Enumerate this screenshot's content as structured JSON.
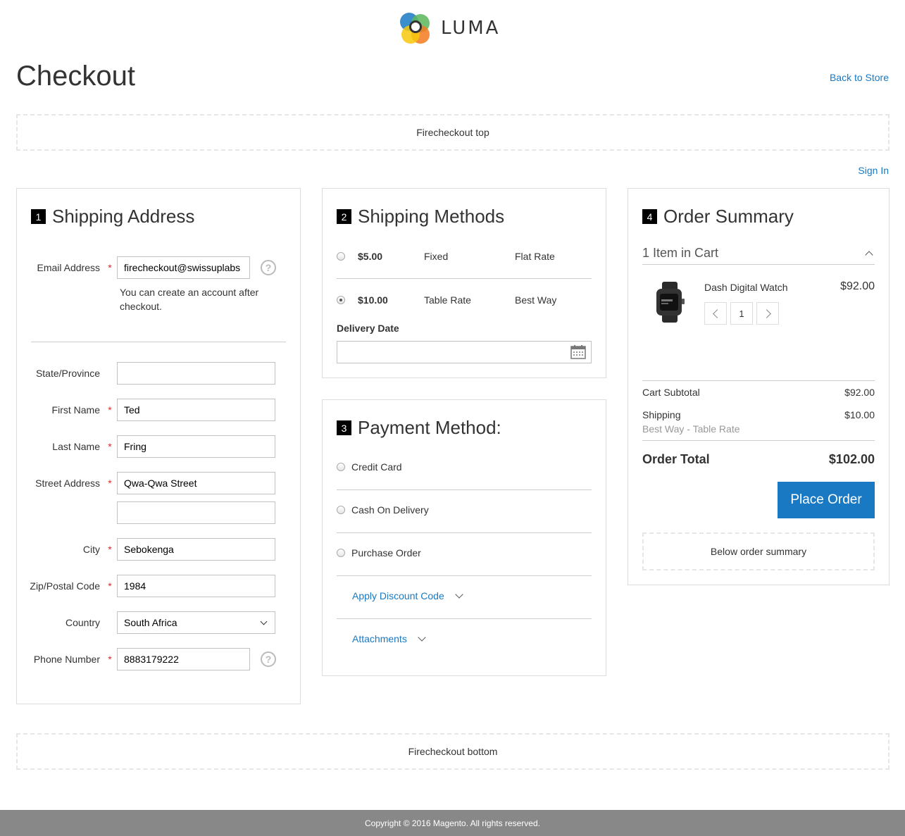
{
  "brand": {
    "name": "LUMA",
    "colors": {
      "blue": "#1979c3",
      "green": "#5bb75b",
      "orange": "#f47a20",
      "yellow": "#f7c80c"
    }
  },
  "header": {
    "title": "Checkout",
    "back_link": "Back to Store"
  },
  "top_box": "Firecheckout top",
  "sign_in": "Sign In",
  "shipping_address": {
    "step": "1",
    "title": "Shipping Address",
    "email": {
      "label": "Email Address",
      "value": "firecheckout@swissuplabs",
      "note": "You can create an account after checkout."
    },
    "state": {
      "label": "State/Province",
      "value": ""
    },
    "first_name": {
      "label": "First Name",
      "value": "Ted"
    },
    "last_name": {
      "label": "Last Name",
      "value": "Fring"
    },
    "street": {
      "label": "Street Address",
      "value": "Qwa-Qwa Street",
      "value2": ""
    },
    "city": {
      "label": "City",
      "value": "Sebokenga"
    },
    "zip": {
      "label": "Zip/Postal Code",
      "value": "1984"
    },
    "country": {
      "label": "Country",
      "value": "South Africa"
    },
    "phone": {
      "label": "Phone Number",
      "value": "8883179222"
    },
    "help_glyph": "?",
    "required_mark": "*"
  },
  "shipping_methods": {
    "step": "2",
    "title": "Shipping Methods",
    "options": [
      {
        "price": "$5.00",
        "method": "Fixed",
        "carrier": "Flat Rate",
        "selected": false
      },
      {
        "price": "$10.00",
        "method": "Table Rate",
        "carrier": "Best Way",
        "selected": true
      }
    ],
    "delivery_date_label": "Delivery Date",
    "delivery_date_value": ""
  },
  "payment": {
    "step": "3",
    "title": "Payment Method:",
    "options": [
      "Credit Card",
      "Cash On Delivery",
      "Purchase Order"
    ],
    "discount_link": "Apply Discount Code",
    "attachments_link": "Attachments"
  },
  "order_summary": {
    "step": "4",
    "title": "Order Summary",
    "items_in_cart": "1 Item in Cart",
    "item": {
      "name": "Dash Digital Watch",
      "price": "$92.00",
      "qty": "1"
    },
    "cart_subtotal_label": "Cart Subtotal",
    "cart_subtotal": "$92.00",
    "shipping_label": "Shipping",
    "shipping_detail": "Best Way - Table Rate",
    "shipping_value": "$10.00",
    "order_total_label": "Order Total",
    "order_total": "$102.00",
    "place_order": "Place Order",
    "below_summary": "Below order summary"
  },
  "bottom_box": "Firecheckout bottom",
  "footer": "Copyright © 2016 Magento. All rights reserved."
}
